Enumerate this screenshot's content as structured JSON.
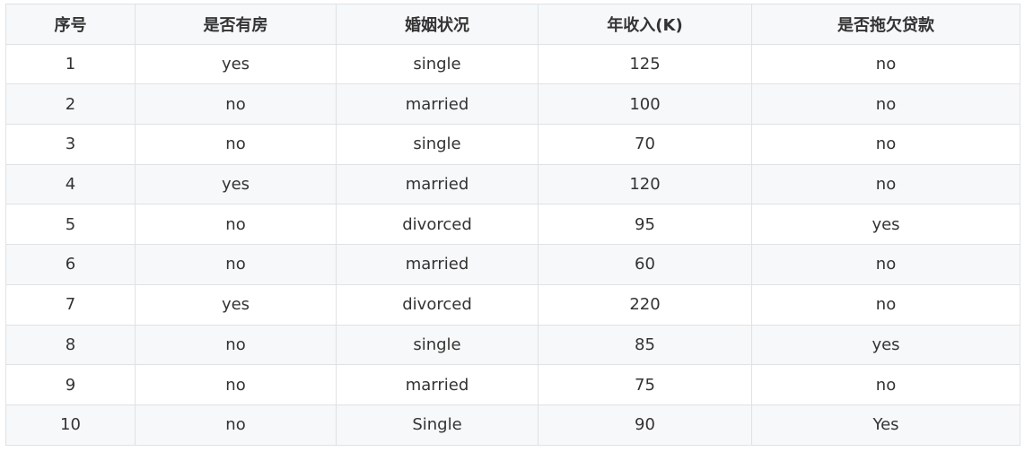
{
  "table": {
    "headers": [
      "序号",
      "是否有房",
      "婚姻状况",
      "年收入(K)",
      "是否拖欠贷款"
    ],
    "rows": [
      [
        "1",
        "yes",
        "single",
        "125",
        "no"
      ],
      [
        "2",
        "no",
        "married",
        "100",
        "no"
      ],
      [
        "3",
        "no",
        "single",
        "70",
        "no"
      ],
      [
        "4",
        "yes",
        "married",
        "120",
        "no"
      ],
      [
        "5",
        "no",
        "divorced",
        "95",
        "yes"
      ],
      [
        "6",
        "no",
        "married",
        "60",
        "no"
      ],
      [
        "7",
        "yes",
        "divorced",
        "220",
        "no"
      ],
      [
        "8",
        "no",
        "single",
        "85",
        "yes"
      ],
      [
        "9",
        "no",
        "married",
        "75",
        "no"
      ],
      [
        "10",
        "no",
        "Single",
        "90",
        "Yes"
      ]
    ]
  }
}
